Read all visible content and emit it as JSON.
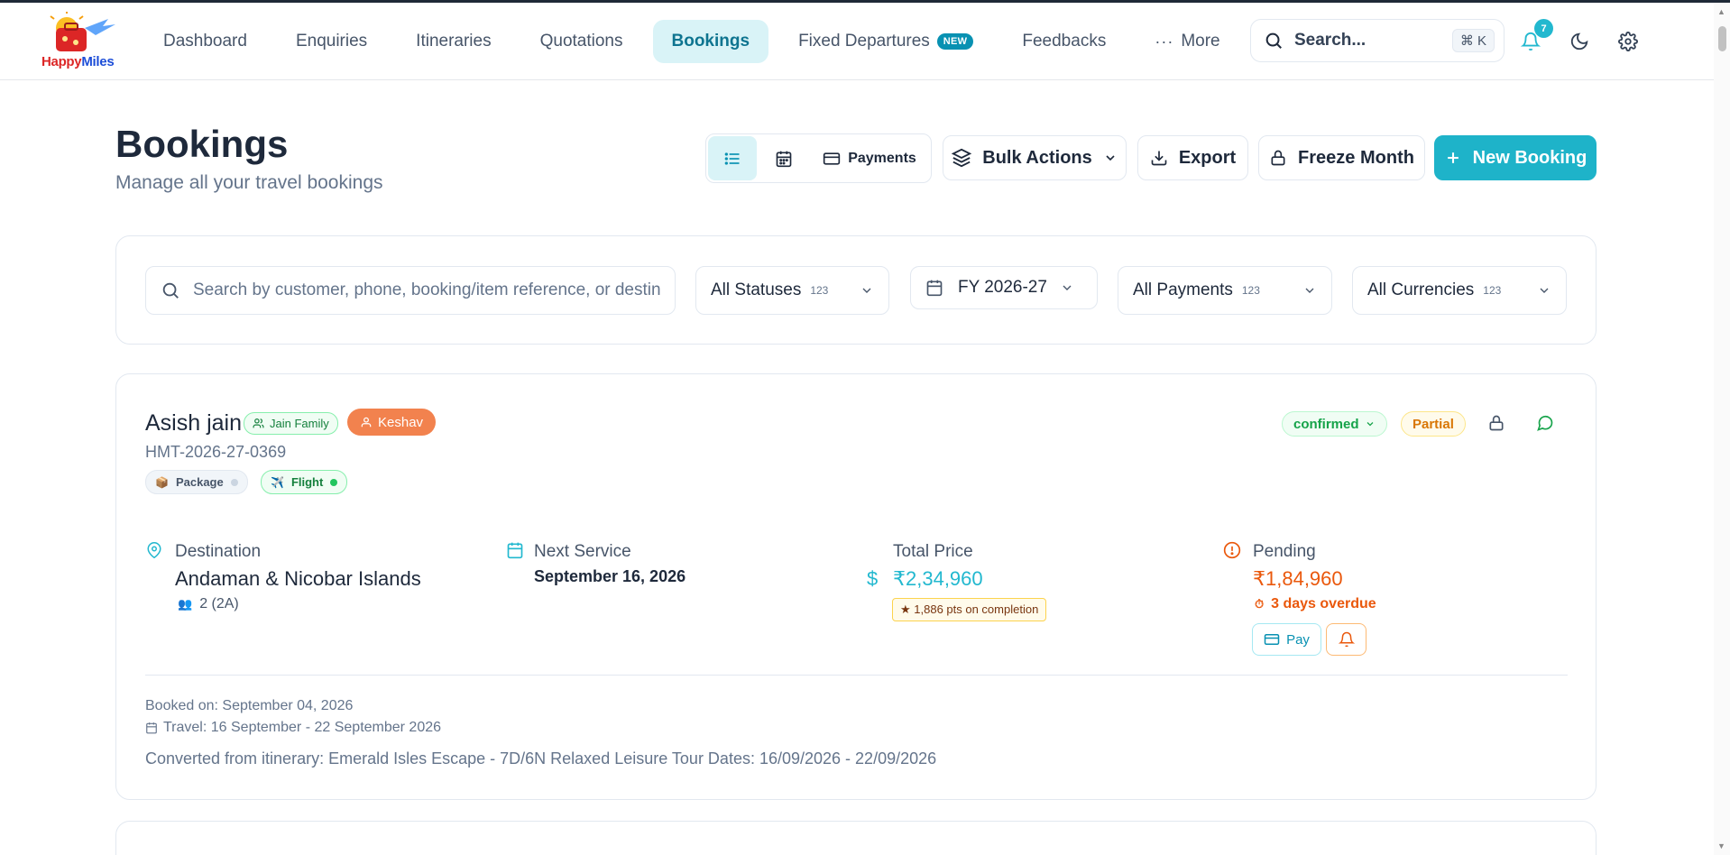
{
  "app": {
    "logo_text_a": "Happy",
    "logo_text_b": "Miles"
  },
  "nav": {
    "items": [
      {
        "label": "Dashboard"
      },
      {
        "label": "Enquiries"
      },
      {
        "label": "Itineraries"
      },
      {
        "label": "Quotations"
      },
      {
        "label": "Bookings",
        "active": true
      },
      {
        "label": "Fixed Departures",
        "badge": "NEW"
      },
      {
        "label": "Feedbacks"
      },
      {
        "label": "More"
      }
    ]
  },
  "header": {
    "search_label": "Search...",
    "search_shortcut": "⌘ K",
    "notification_count": "7"
  },
  "page": {
    "title": "Bookings",
    "subtitle": "Manage all your travel bookings"
  },
  "toolbar": {
    "payments_label": "Payments",
    "bulk_actions_label": "Bulk Actions",
    "export_label": "Export",
    "freeze_label": "Freeze Month",
    "new_booking_label": "New Booking"
  },
  "filters": {
    "search_placeholder": "Search by customer, phone, booking/item reference, or destination",
    "status": {
      "value": "All Statuses",
      "count": "123"
    },
    "fiscal_year": {
      "value": "FY 2026-27"
    },
    "payments": {
      "value": "All Payments",
      "count": "123"
    },
    "currencies": {
      "value": "All Currencies",
      "count": "123"
    }
  },
  "booking": {
    "customer": "Asish jain",
    "group": "Jain Family",
    "agent": "Keshav",
    "reference": "HMT-2026-27-0369",
    "services": [
      {
        "label": "Package",
        "icon": "package-icon"
      },
      {
        "label": "Flight",
        "icon": "airplane-icon"
      }
    ],
    "status": "confirmed",
    "payment_status": "Partial",
    "destination_label": "Destination",
    "destination": "Andaman & Nicobar Islands",
    "travellers": "2 (2A)",
    "next_service_label": "Next Service",
    "next_service": "September 16, 2026",
    "total_price_label": "Total Price",
    "currency_symbol": "$",
    "total_price": "₹2,34,960",
    "points": "★ 1,886 pts on completion",
    "pending_label": "Pending",
    "pending_amount": "₹1,84,960",
    "overdue": "3 days overdue",
    "pay_label": "Pay",
    "booked_on": "Booked on: September 04, 2026",
    "travel_dates": "Travel: 16 September - 22 September 2026",
    "converted_from": "Converted from itinerary: Emerald Isles Escape - 7D/6N Relaxed Leisure Tour Dates: 16/09/2026 - 22/09/2026"
  },
  "colors": {
    "accent": "#1eb3c9",
    "confirmed": "#16a34a",
    "partial": "#d97706",
    "pending": "#ea580c",
    "agent_chip": "#f2824e"
  }
}
